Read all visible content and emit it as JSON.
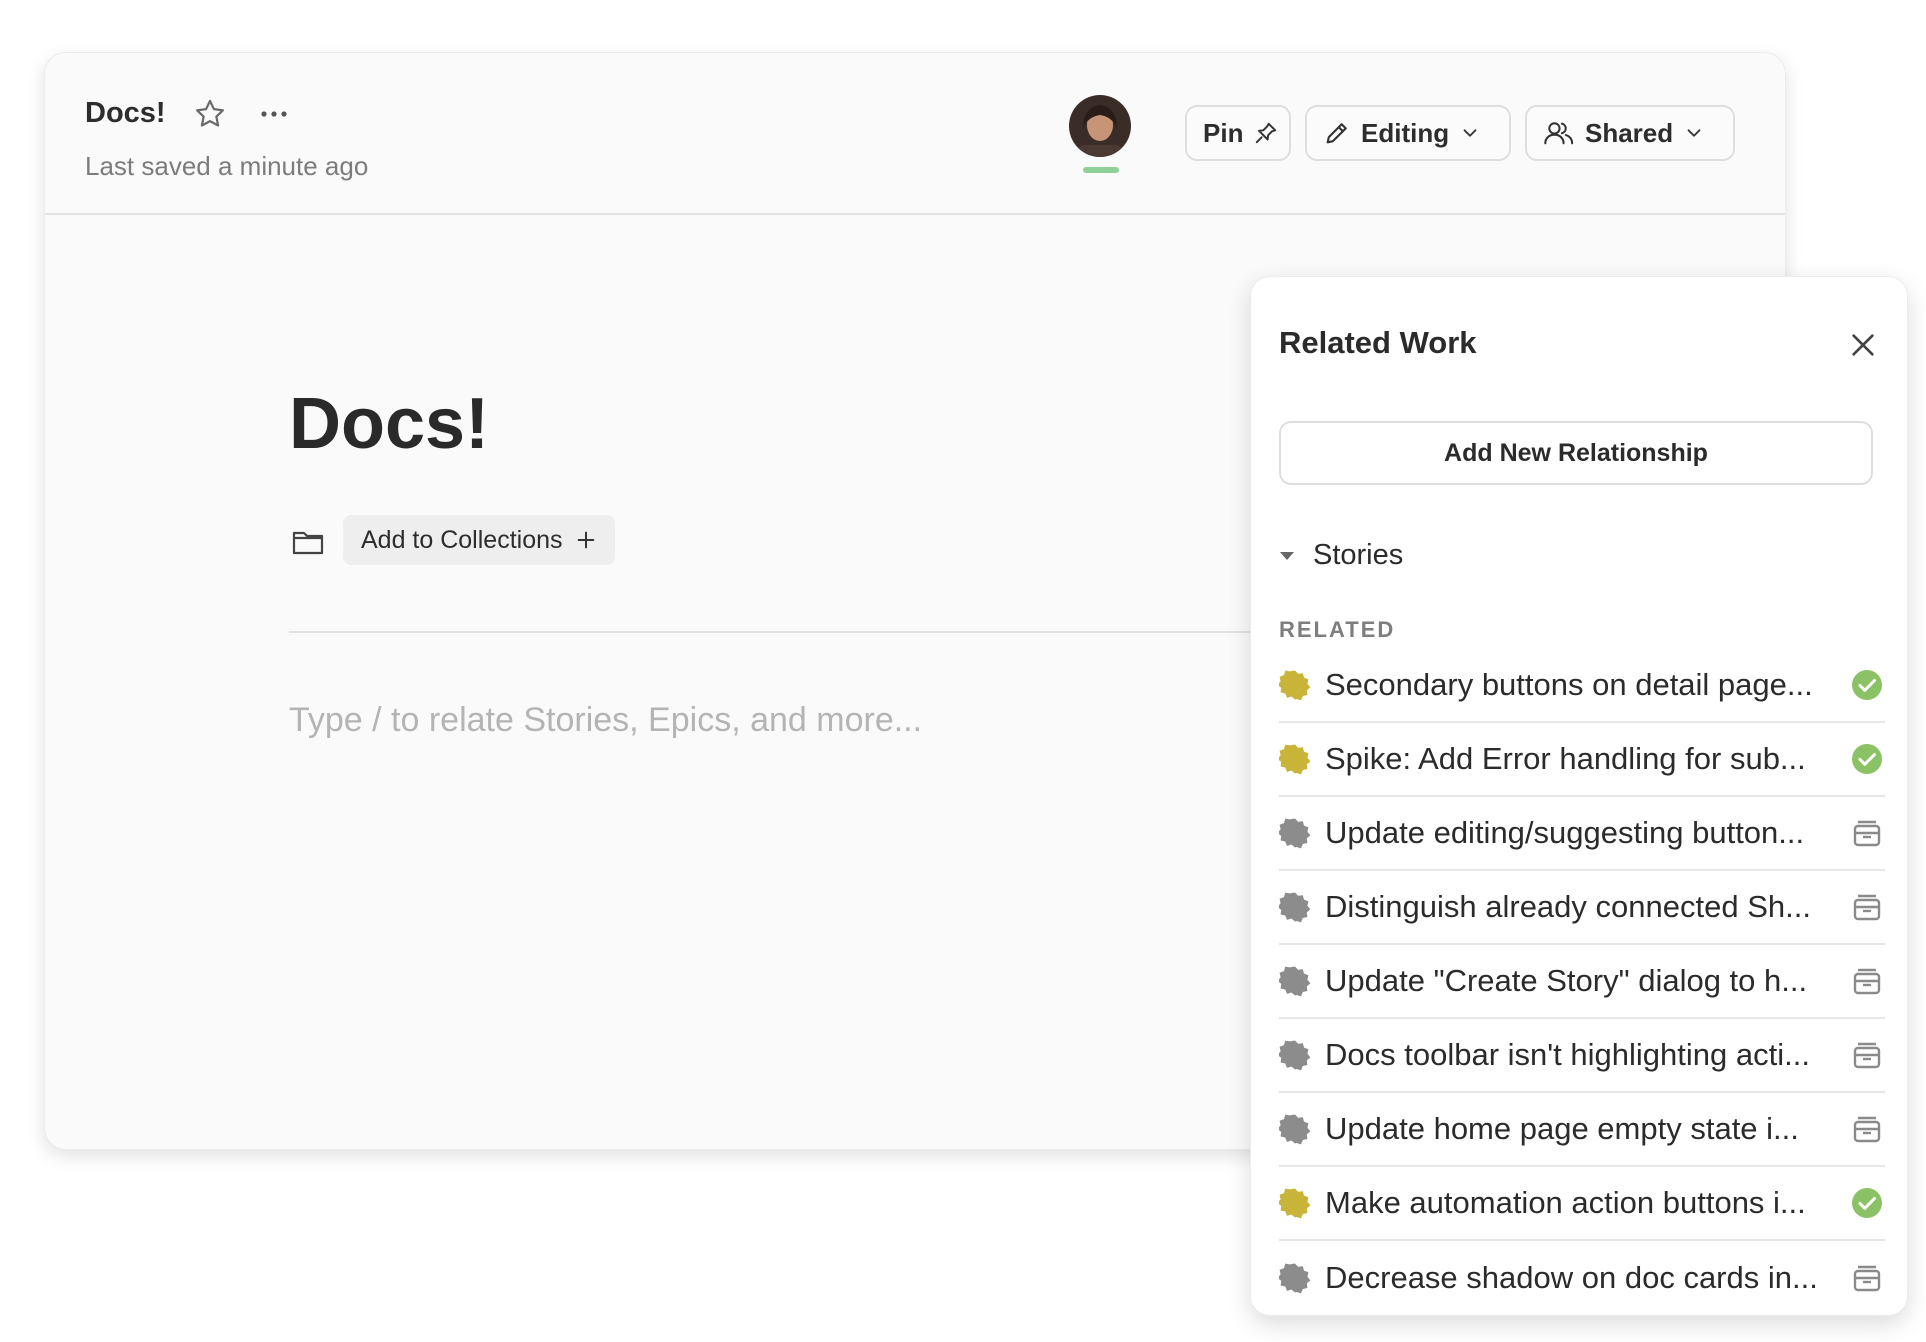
{
  "header": {
    "title": "Docs!",
    "last_saved": "Last saved a minute ago",
    "pin_label": "Pin",
    "editing_label": "Editing",
    "shared_label": "Shared"
  },
  "doc": {
    "title": "Docs!",
    "add_collections_label": "Add to Collections",
    "editor_placeholder": "Type / to relate Stories, Epics, and more..."
  },
  "panel": {
    "title": "Related Work",
    "add_button": "Add New Relationship",
    "section_label": "Stories",
    "group_label": "RELATED",
    "stories": [
      {
        "title": "Secondary buttons on detail page...",
        "state": "active",
        "status": "done"
      },
      {
        "title": "Spike: Add Error handling for sub...",
        "state": "active",
        "status": "done"
      },
      {
        "title": "Update editing/suggesting button...",
        "state": "inactive",
        "status": "archived"
      },
      {
        "title": "Distinguish already connected Sh...",
        "state": "inactive",
        "status": "archived"
      },
      {
        "title": "Update \"Create Story\" dialog to h...",
        "state": "inactive",
        "status": "archived"
      },
      {
        "title": "Docs toolbar isn't highlighting acti...",
        "state": "inactive",
        "status": "archived"
      },
      {
        "title": "Update home page empty state i...",
        "state": "inactive",
        "status": "archived"
      },
      {
        "title": "Make automation action buttons i...",
        "state": "active",
        "status": "done"
      },
      {
        "title": "Decrease shadow on doc cards in...",
        "state": "inactive",
        "status": "archived"
      }
    ]
  },
  "colors": {
    "active_state": "#c9b43a",
    "inactive_state": "#8c8c8c",
    "done_status": "#8cc266",
    "archived_status": "#8a8a8a",
    "presence": "#8fcf98"
  }
}
